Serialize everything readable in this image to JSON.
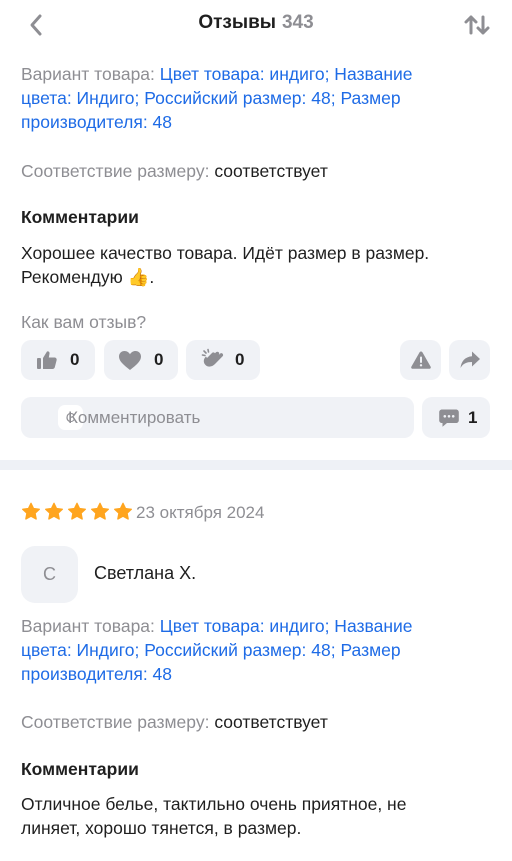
{
  "header": {
    "title": "Отзывы",
    "count": "343",
    "back_icon": "chevron-left-icon",
    "sort_icon": "sort-arrows-icon"
  },
  "review1": {
    "variant_label": "Вариант товара:",
    "variant_lines": [
      "Цвет товара: индиго; Название",
      "цвета: Индиго; Российский размер: 48; Размер",
      "производителя: 48"
    ],
    "size_label": "Соответствие размеру:",
    "size_value": "соответствует",
    "comments_heading": "Комментарии",
    "comment_lines": [
      "Хорошее качество товара. Идёт размер в размер.",
      "Рекомендую 👍."
    ],
    "helpful_question": "Как вам отзыв?",
    "reactions": [
      {
        "icon": "thumbs-up-icon",
        "count": "0"
      },
      {
        "icon": "heart-icon",
        "count": "0"
      },
      {
        "icon": "clap-icon",
        "count": "0"
      }
    ],
    "report_icon": "warning-icon",
    "share_icon": "share-arrow-icon",
    "comment_avatar_letter": "С",
    "comment_placeholder": "Комментировать",
    "comments_count": "1"
  },
  "review2": {
    "rating": 5,
    "date": "23 октября 2024",
    "avatar_letter": "С",
    "author": "Светлана Х.",
    "variant_label": "Вариант товара:",
    "variant_lines": [
      "Цвет товара: индиго; Название",
      "цвета: Индиго; Российский размер: 48; Размер",
      "производителя: 48"
    ],
    "size_label": "Соответствие размеру:",
    "size_value": "соответствует",
    "comments_heading": "Комментарии",
    "comment_lines": [
      "Отличное белье, тактильно очень приятное, не",
      "линяет, хорошо тянется, в размер."
    ]
  },
  "colors": {
    "accent_link": "#1e6be6",
    "muted": "#8e8e93",
    "star": "#ffa51f",
    "pill_bg": "#f0f2f6"
  }
}
